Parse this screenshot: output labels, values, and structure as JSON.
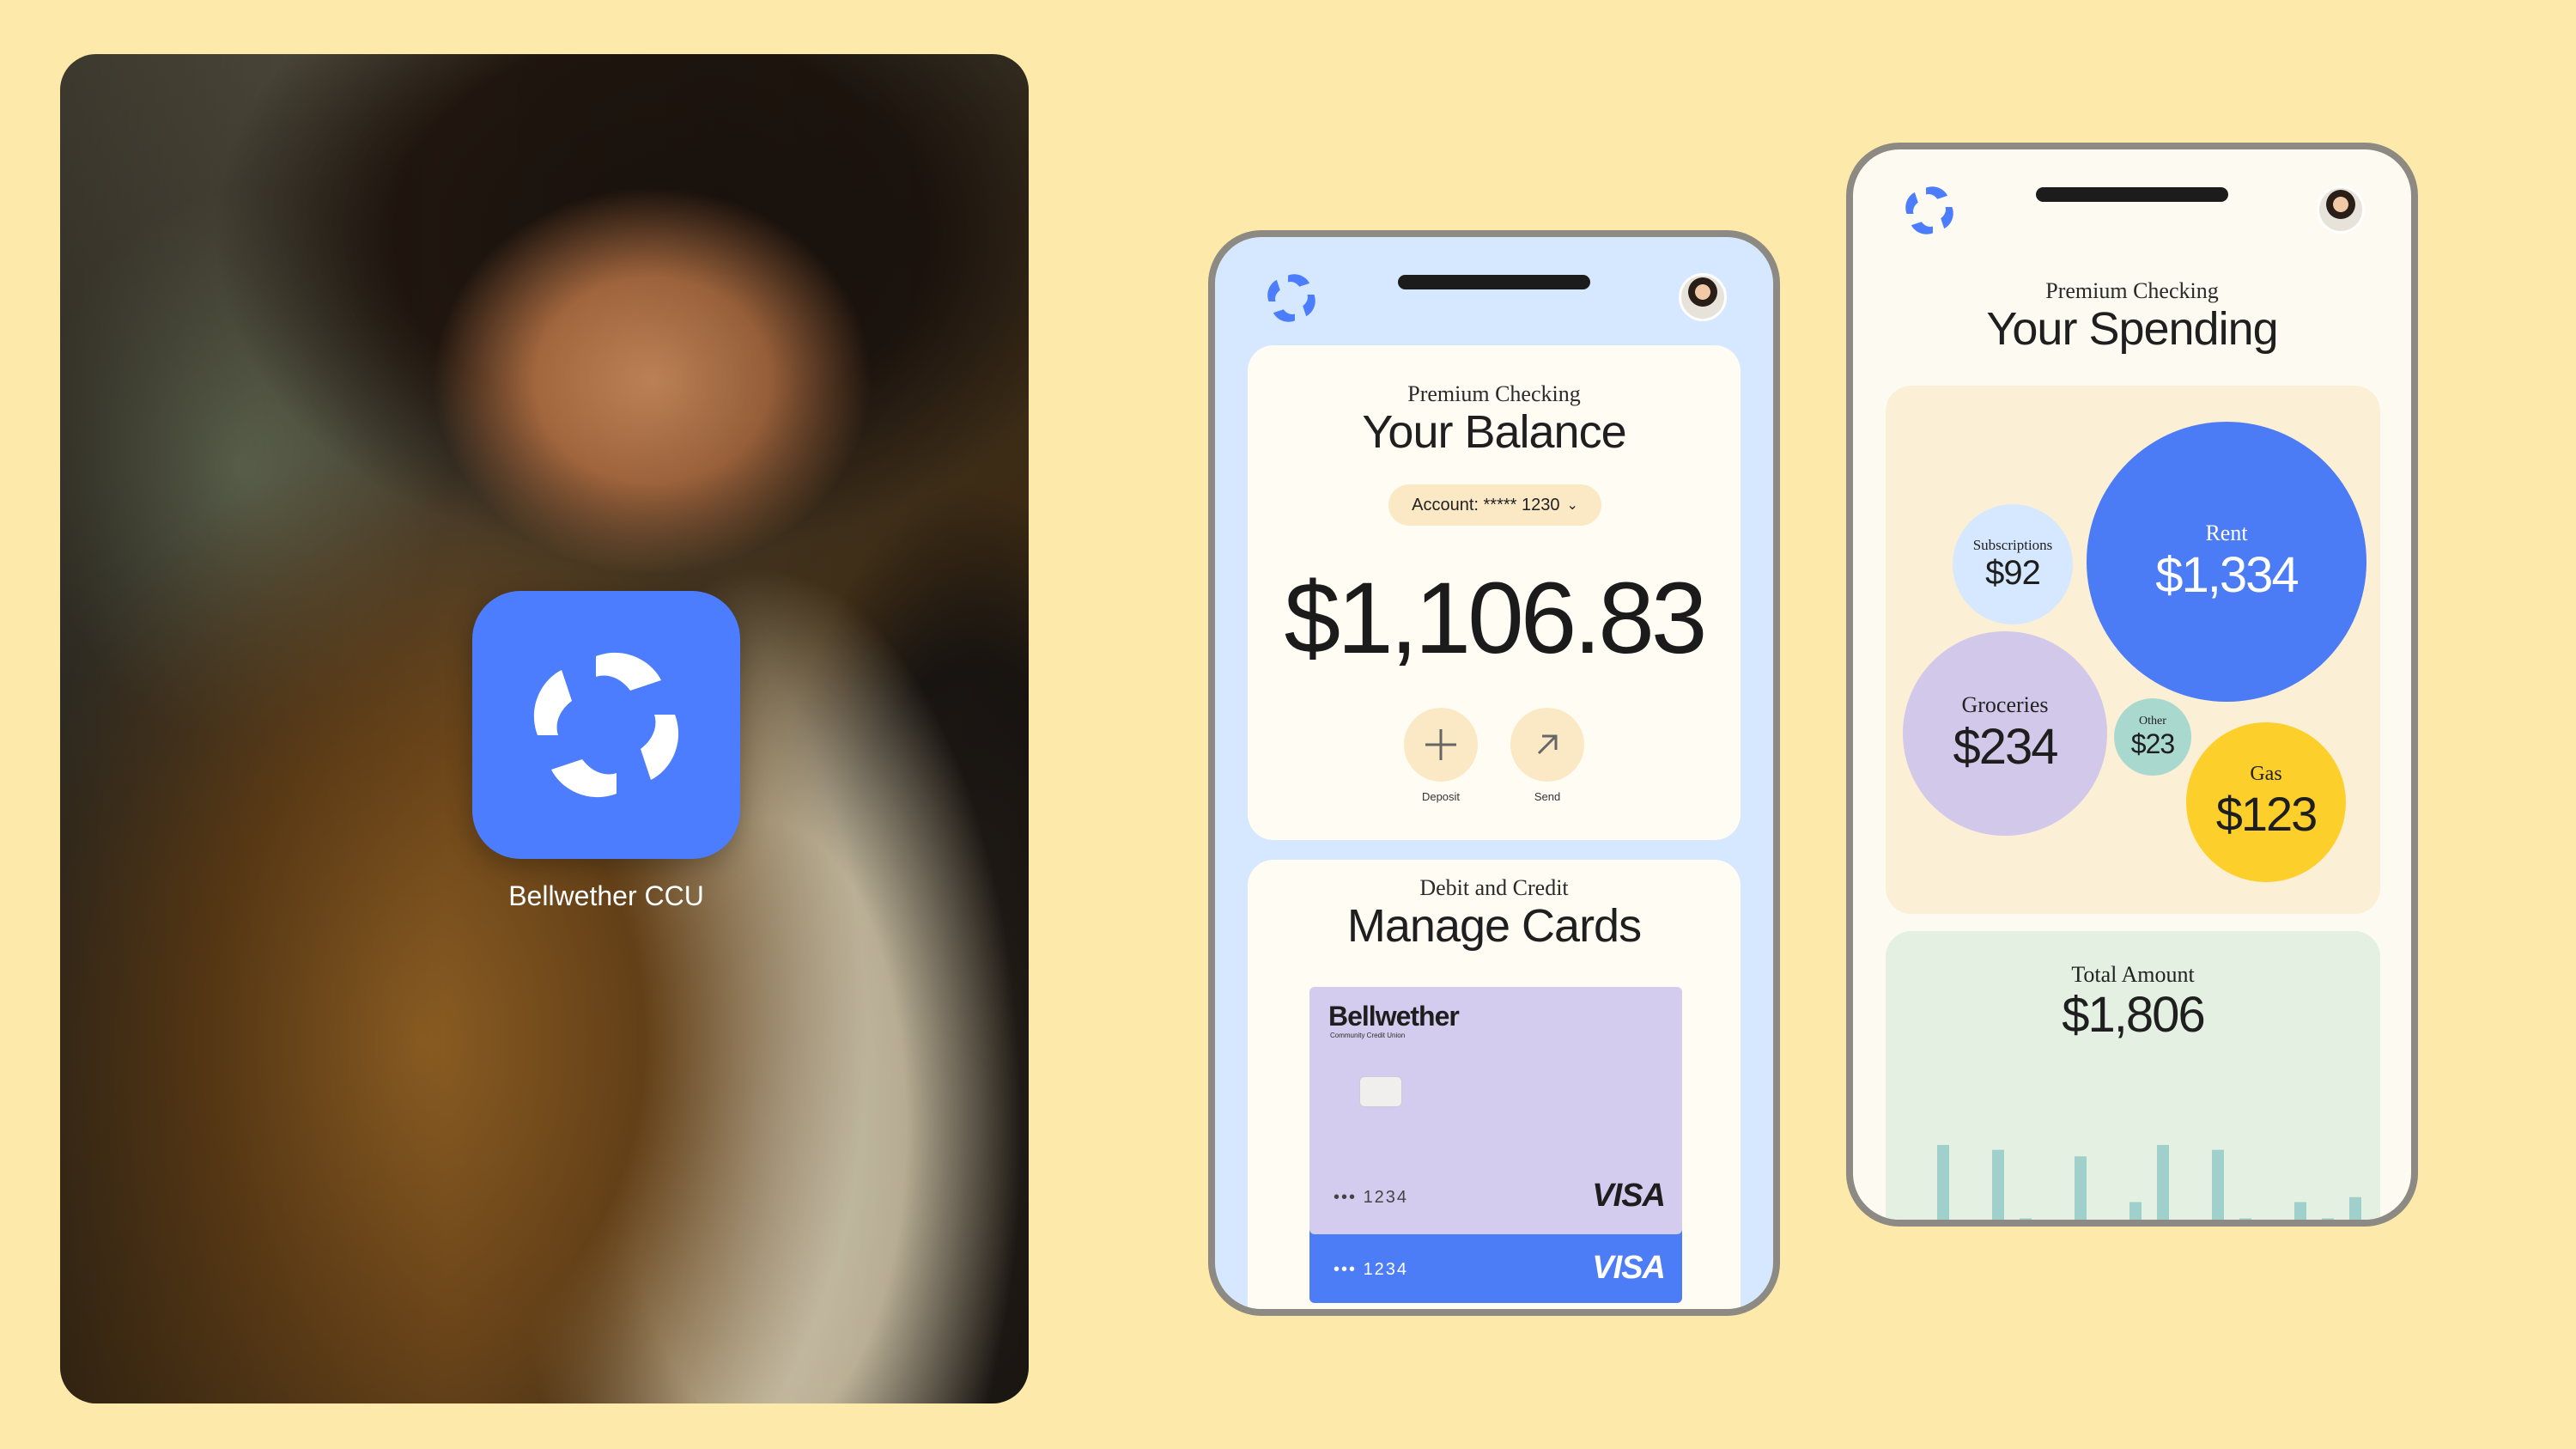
{
  "app_icon": {
    "label": "Bellwether CCU"
  },
  "balance_screen": {
    "subtitle": "Premium Checking",
    "title": "Your Balance",
    "account": "Account: ***** 1230",
    "balance": "$1,106.83",
    "actions": [
      {
        "label": "Deposit",
        "icon": "plus-icon"
      },
      {
        "label": "Send",
        "icon": "arrow-up-right-icon"
      }
    ],
    "cards_subtitle": "Debit and Credit",
    "cards_title": "Manage Cards",
    "card": {
      "brand": "Bellwether",
      "brand_sub": "Community Credit Union",
      "number": "••• 1234",
      "network": "VISA"
    },
    "card2": {
      "number": "••• 1234",
      "network": "VISA"
    }
  },
  "spending_screen": {
    "subtitle": "Premium Checking",
    "title": "Your Spending",
    "categories": [
      {
        "name": "Subscriptions",
        "amount": "$92",
        "color": "#d6e8ff"
      },
      {
        "name": "Rent",
        "amount": "$1,334",
        "color": "#4b7bf5"
      },
      {
        "name": "Groceries",
        "amount": "$234",
        "color": "#d2c8ea"
      },
      {
        "name": "Other",
        "amount": "$23",
        "color": "#a9d8cf"
      },
      {
        "name": "Gas",
        "amount": "$123",
        "color": "#fccf2a"
      }
    ],
    "total_label": "Total Amount",
    "total": "$1,806",
    "bar_values": [
      0.9,
      0.33,
      0.87,
      0.45,
      0.1,
      0.83,
      0.13,
      0.55,
      0.9,
      0.33,
      0.87,
      0.45,
      0.1,
      0.55,
      0.45,
      0.58
    ],
    "bar_color": "#9fd0cb"
  },
  "colors": {
    "background": "#fde9a9",
    "accent": "#4c7dff"
  }
}
